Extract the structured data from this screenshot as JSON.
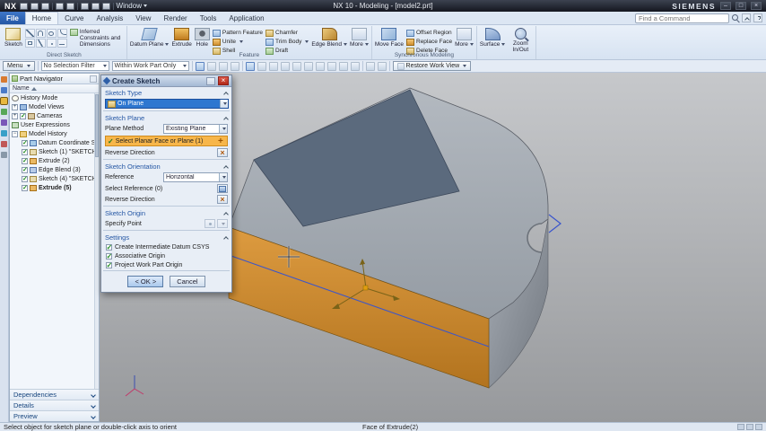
{
  "window": {
    "app_logo": "NX",
    "title": "NX 10 - Modeling - [model2.prt]",
    "brand": "SIEMENS",
    "window_menu_label": "Window"
  },
  "tabs": {
    "items": [
      "File",
      "Home",
      "Curve",
      "Analysis",
      "View",
      "Render",
      "Tools",
      "Application"
    ],
    "active": "Home",
    "find_command_placeholder": "Find a Command"
  },
  "ribbon": {
    "direct_sketch": {
      "group_label": "Direct Sketch",
      "sketch": "Sketch",
      "inferred": "Inferred Constraints and Dimensions"
    },
    "feature": {
      "group_label": "Feature",
      "datum_plane": "Datum Plane",
      "extrude": "Extrude",
      "hole": "Hole",
      "pattern_feature": "Pattern Feature",
      "unite": "Unite",
      "shell": "Shell",
      "chamfer": "Chamfer",
      "trim_body": "Trim Body",
      "draft": "Draft",
      "edge_blend": "Edge Blend",
      "more": "More"
    },
    "synchronous": {
      "group_label": "Synchronous Modeling",
      "move_face": "Move Face",
      "offset_region": "Offset Region",
      "replace_face": "Replace Face",
      "delete_face": "Delete Face",
      "more": "More"
    },
    "surface": "Surface",
    "zoom": "Zoom In/Out"
  },
  "toolbar": {
    "menu_label": "Menu",
    "selection_filter": "No Selection Filter",
    "selection_scope": "Within Work Part Only",
    "restore_work_view": "Restore Work View"
  },
  "part_navigator": {
    "title": "Part Navigator",
    "column_name": "Name",
    "items": [
      {
        "label": "History Mode",
        "checked": false
      },
      {
        "label": "Model Views",
        "checked": false
      },
      {
        "label": "Cameras",
        "checked": true
      },
      {
        "label": "User Expressions",
        "checked": false
      },
      {
        "label": "Model History",
        "checked": false
      },
      {
        "label": "Datum Coordinate Sys...",
        "checked": true
      },
      {
        "label": "Sketch (1) \"SKETCH_00...",
        "checked": true
      },
      {
        "label": "Extrude (2)",
        "checked": true
      },
      {
        "label": "Edge Blend (3)",
        "checked": true
      },
      {
        "label": "Sketch (4) \"SKETCH_0...",
        "checked": true
      },
      {
        "label": "Extrude (5)",
        "checked": true,
        "bold": true
      }
    ],
    "sections": [
      "Dependencies",
      "Details",
      "Preview"
    ]
  },
  "dialog": {
    "title": "Create Sketch",
    "sketch_type": {
      "header": "Sketch Type",
      "value": "On Plane"
    },
    "sketch_plane": {
      "header": "Sketch Plane",
      "plane_method_label": "Plane Method",
      "plane_method_value": "Existing Plane",
      "select_face": "Select Planar Face or Plane (1)",
      "reverse_direction": "Reverse Direction"
    },
    "sketch_orientation": {
      "header": "Sketch Orientation",
      "reference_label": "Reference",
      "reference_value": "Horizontal",
      "select_reference": "Select Reference (0)",
      "reverse_direction": "Reverse Direction"
    },
    "sketch_origin": {
      "header": "Sketch Origin",
      "specify_point": "Specify Point"
    },
    "settings": {
      "header": "Settings",
      "checkboxes": [
        {
          "label": "Create Intermediate Datum CSYS",
          "checked": true
        },
        {
          "label": "Associative Origin",
          "checked": true
        },
        {
          "label": "Project Work Part Origin",
          "checked": true
        }
      ]
    },
    "ok_label": "< OK >",
    "cancel_label": "Cancel"
  },
  "status_bar": {
    "message": "Select object for sketch plane or double-click axis to orient",
    "context": "Face of Extrude(2)"
  },
  "icons": {
    "find_command": "magnifier",
    "dialog_close": "×",
    "check": "✓",
    "dropdown_arrow": "▾",
    "section_collapse": "chevron-up",
    "panel_section_collapse": "chevron-down",
    "sort_ascending": "▲",
    "reverse_direction": "×-swap",
    "select_target": "+"
  },
  "colors": {
    "selection_blue": "#2e77d0",
    "highlight_orange": "#f7b64a",
    "model_orange": "#d08a32",
    "selected_face": "#5b6a7d",
    "accent_blue_text": "#2456a4"
  }
}
